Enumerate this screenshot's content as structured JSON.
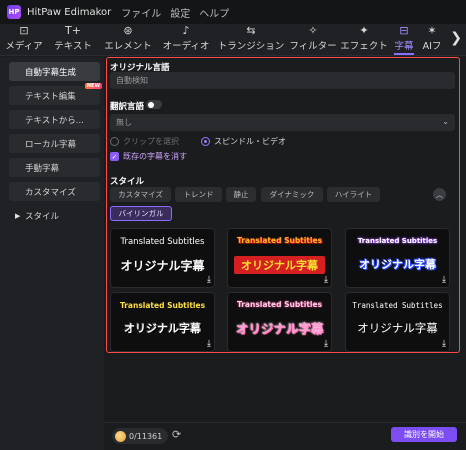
{
  "app": {
    "title": "HitPaw Edimakor",
    "logo_text": "HP"
  },
  "menu": [
    "ファイル",
    "設定",
    "ヘルプ"
  ],
  "toolbar": {
    "tabs": [
      {
        "label": "メディア",
        "icon": "media-icon",
        "glyph": "⊡"
      },
      {
        "label": "テキスト",
        "icon": "text-icon",
        "glyph": "T+"
      },
      {
        "label": "エレメント",
        "icon": "element-icon",
        "glyph": "⊛"
      },
      {
        "label": "オーディオ",
        "icon": "audio-icon",
        "glyph": "♪"
      },
      {
        "label": "トランジション",
        "icon": "transition-icon",
        "glyph": "⇆"
      },
      {
        "label": "フィルター",
        "icon": "filter-icon",
        "glyph": "✧"
      },
      {
        "label": "エフェクト",
        "icon": "effect-icon",
        "glyph": "✦"
      },
      {
        "label": "字幕",
        "icon": "subtitle-icon",
        "glyph": "⊟"
      },
      {
        "label": "AIフ",
        "icon": "ai-icon",
        "glyph": "✶"
      }
    ],
    "active_index": 7,
    "more_glyph": "❯"
  },
  "sidebar": {
    "items": [
      {
        "label": "自動字幕生成"
      },
      {
        "label": "テキスト編集",
        "badge": "NEW"
      },
      {
        "label": "テキストから..."
      },
      {
        "label": "ローカル字幕"
      },
      {
        "label": "手動字幕"
      },
      {
        "label": "カスタマイズ"
      },
      {
        "label": "スタイル",
        "caret": "▶"
      }
    ]
  },
  "panel": {
    "original_language_label": "オリジナル言語",
    "original_language_value": "自動検知",
    "translation_label": "翻訳言語",
    "translation_value": "無し",
    "chevron": "⌄",
    "radio_clip": "クリップを選択",
    "radio_spindle": "スピンドル・ビデオ",
    "check_delete": "既存の字幕を消す",
    "check_mark": "✓",
    "style_label": "スタイル",
    "style_chips": [
      "カスタマイズ",
      "トレンド",
      "静止",
      "ダイナミック",
      "ハイライト"
    ],
    "selected_chip": "バイリンガル",
    "collapse_glyph": "︿"
  },
  "cards": [
    {
      "en": "Translated Subtitles",
      "jp": "オリジナル字幕"
    },
    {
      "en": "Translated Subtitles",
      "jp": "オリジナル字幕"
    },
    {
      "en": "Translated Subtitles",
      "jp": "オリジナル字幕"
    },
    {
      "en": "Translated Subtitles",
      "jp": "オリジナル字幕"
    },
    {
      "en": "Translated Subtitles",
      "jp": "オリジナル字幕"
    },
    {
      "en": "Translated Subtitles",
      "jp": "オリジナル字幕"
    }
  ],
  "download_glyph": "⤓",
  "bottom": {
    "credits": "0/11361",
    "refresh_glyph": "⟳",
    "start_button": "識別を開始"
  },
  "colors": {
    "accent": "#8a6cff",
    "highlight_border": "#ff4a4a",
    "start_button": "#7b4df2"
  }
}
